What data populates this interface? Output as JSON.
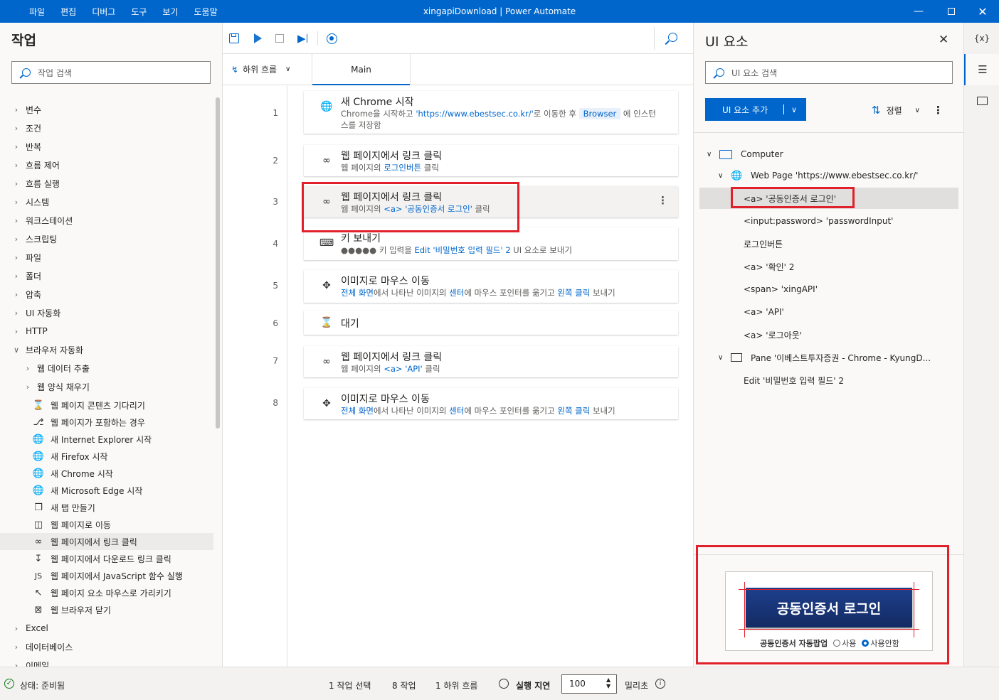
{
  "window": {
    "title": "xingapiDownload | Power Automate",
    "menu": [
      "파일",
      "편집",
      "디버그",
      "도구",
      "보기",
      "도움말"
    ],
    "accent": "#0066cc"
  },
  "actions_panel": {
    "title": "작업",
    "search_placeholder": "작업 검색",
    "categories": [
      "변수",
      "조건",
      "반복",
      "흐름 제어",
      "흐름 실행",
      "시스템",
      "워크스테이션",
      "스크립팅",
      "파일",
      "폴더",
      "압축",
      "UI 자동화",
      "HTTP",
      "브라우저 자동화"
    ],
    "browser_subcategories": [
      "웹 데이터 추출",
      "웹 양식 채우기"
    ],
    "browser_actions": [
      {
        "label": "웹 페이지 콘텐츠 기다리기",
        "icon": "hourglass-icon"
      },
      {
        "label": "웹 페이지가 포함하는 경우",
        "icon": "branch-icon"
      },
      {
        "label": "새 Internet Explorer 시작",
        "icon": "globe-icon"
      },
      {
        "label": "새 Firefox 시작",
        "icon": "globe-icon"
      },
      {
        "label": "새 Chrome 시작",
        "icon": "globe-icon"
      },
      {
        "label": "새 Microsoft Edge 시작",
        "icon": "globe-icon"
      },
      {
        "label": "새 탭 만들기",
        "icon": "new-tab-icon"
      },
      {
        "label": "웹 페이지로 이동",
        "icon": "window-icon"
      },
      {
        "label": "웹 페이지에서 링크 클릭",
        "icon": "link-icon"
      },
      {
        "label": "웹 페이지에서 다운로드 링크 클릭",
        "icon": "download-icon"
      },
      {
        "label": "웹 페이지에서 JavaScript 함수 실행",
        "icon": "js-icon"
      },
      {
        "label": "웹 페이지 요소 마우스로 가리키기",
        "icon": "pointer-icon"
      },
      {
        "label": "웹 브라우저 닫기",
        "icon": "close-box-icon"
      }
    ],
    "more_categories": [
      "Excel",
      "데이터베이스",
      "이메일"
    ]
  },
  "designer": {
    "subflow_label": "하위 흐름",
    "main_tab": "Main",
    "steps": [
      {
        "num": "1",
        "title": "새 Chrome 시작",
        "d1": "Chrome을 시작하고 ",
        "link1": "'https://www.ebestsec.co.kr/'",
        "d2": "로 이동한 후 ",
        "chip": "Browser",
        "d3": " 에 인스턴",
        "d4": "스를 저장함"
      },
      {
        "num": "2",
        "title": "웹 페이지에서 링크 클릭",
        "d1": "웹 페이지의 ",
        "link1": "로그인버튼",
        "d2": " 클릭"
      },
      {
        "num": "3",
        "title": "웹 페이지에서 링크 클릭",
        "d1": "웹 페이지의 ",
        "link1": "<a> '공동인증서 로그인'",
        "d2": " 클릭"
      },
      {
        "num": "4",
        "title": "키 보내기",
        "d1": "●●●●● 키 입력을 ",
        "link1": "Edit '비밀번호 입력 필드' 2",
        "d2": " UI 요소로 보내기"
      },
      {
        "num": "5",
        "title": "이미지로 마우스 이동",
        "link1": "전체 화면",
        "d1": "에서 나타난 이미지의 ",
        "link2": "센터",
        "d2": "에 마우스 포인터를 옮기고 ",
        "link3": "왼쪽 클릭",
        "d3": " 보내기"
      },
      {
        "num": "6",
        "title": "대기"
      },
      {
        "num": "7",
        "title": "웹 페이지에서 링크 클릭",
        "d1": "웹 페이지의 ",
        "link1": "<a> 'API'",
        "d2": " 클릭"
      },
      {
        "num": "8",
        "title": "이미지로 마우스 이동",
        "link1": "전체 화면",
        "d1": "에서 나타난 이미지의 ",
        "link2": "센터",
        "d2": "에 마우스 포인터를 옮기고 ",
        "link3": "왼쪽 클릭",
        "d3": " 보내기"
      }
    ]
  },
  "ui_elements": {
    "title": "UI 요소",
    "search_placeholder": "UI 요소 검색",
    "add_button": "UI 요소 추가",
    "sort_label": "정렬",
    "tree": {
      "computer": "Computer",
      "webpage": "Web Page 'https://www.ebestsec.co.kr/'",
      "web_children": [
        "<a> '공동인증서 로그인'",
        "<input:password> 'passwordInput'",
        "로그인버튼",
        "<a> '확인' 2",
        "<span> 'xingAPI'",
        "<a> 'API'",
        "<a> '로그아웃'"
      ],
      "pane": "Pane '이베스트투자증권 - Chrome - KyungD...",
      "pane_children": [
        "Edit '비밀번호 입력 필드' 2"
      ]
    },
    "preview": {
      "button_text": "공동인증서 로그인",
      "popup_label": "공동인증서 자동팝업",
      "opt_use": "사용",
      "opt_nouse": "사용안함"
    }
  },
  "sidebar_strip": {
    "variables_label": "{x}"
  },
  "statusbar": {
    "status": "상태: 준비됨",
    "selected": "1 작업 선택",
    "actions": "8 작업",
    "subflows": "1 하위 흐름",
    "delay_label": "실행 지연",
    "delay_value": "100",
    "unit": "밀리초"
  }
}
